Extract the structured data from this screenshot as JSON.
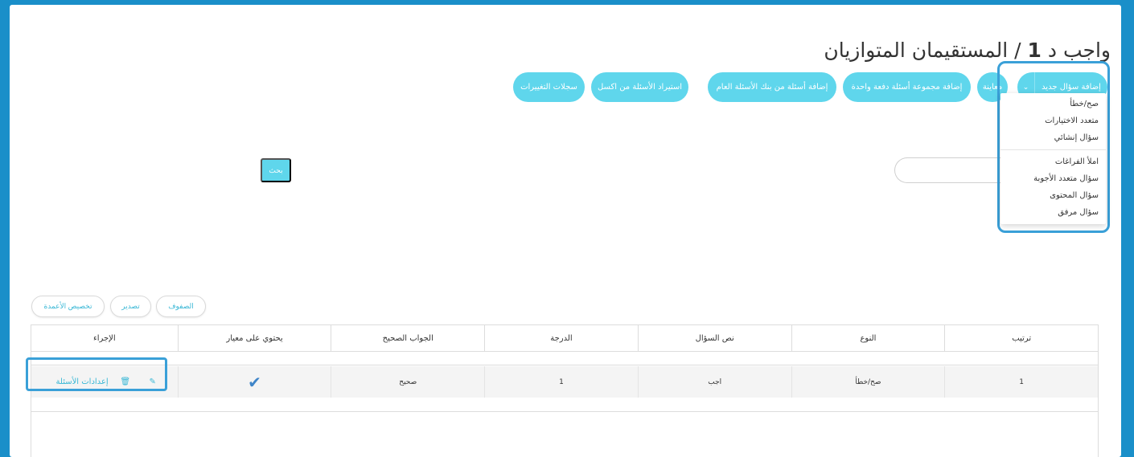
{
  "page": {
    "title_prefix": "واجب د ",
    "title_number": "1",
    "title_suffix": " / المستقيمان المتوازيان"
  },
  "toolbar": {
    "add_question": "إضافة سؤال جديد",
    "caret": "⌄",
    "preview": "معاينة",
    "add_bulk": "إضافة مجموعة أسئلة دفعة واحدة",
    "add_from_bank": "إضافة أسئلة من بنك الأسئلة العام",
    "import_excel": "استيراد الأسئلة من اكسل",
    "change_log": "سجلات التغييرات"
  },
  "dropdown": {
    "group1": [
      "صح/خطأ",
      "متعدد الاختيارات",
      "سؤال إنشائي"
    ],
    "group2": [
      "املأ الفراغات",
      "سؤال متعدد الأجوبة",
      "سؤال المحتوى",
      "سؤال مرفق"
    ]
  },
  "search": {
    "value": "",
    "button": "بحث"
  },
  "table_tools": {
    "rows": "الصفوف",
    "export": "تصدير",
    "customize_columns": "تخصيص الأعمدة"
  },
  "table": {
    "headers": [
      "ترتيب",
      "النوع",
      "نص السؤال",
      "الدرجة",
      "الجواب الصحيح",
      "يحتوي على معيار",
      "الإجراء"
    ],
    "rows": [
      {
        "order": "1",
        "type": "صح/خطأ",
        "text": "اجب",
        "grade": "1",
        "answer": "صحيح",
        "has_rubric": true
      }
    ],
    "action_settings": "إعدادات الأسئلة"
  },
  "colors": {
    "accent": "#5fd6ec",
    "link": "#3bb8d6",
    "highlight": "#3aa0d8",
    "frame": "#1a8fc9",
    "check": "#3f85c8"
  }
}
